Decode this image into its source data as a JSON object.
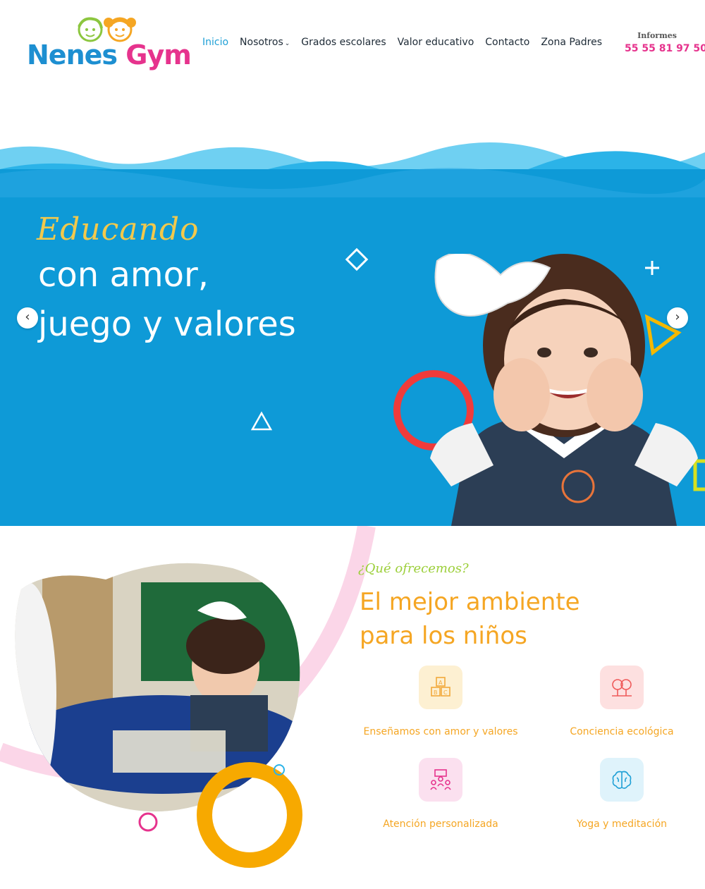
{
  "brand": {
    "name_part1": "Nenes",
    "name_part2": "Gym",
    "colors": {
      "blue": "#1d8fd1",
      "green": "#8cc63f",
      "orange": "#f5a623",
      "pink": "#e6338d"
    }
  },
  "nav": {
    "items": [
      {
        "label": "Inicio",
        "active": true
      },
      {
        "label": "Nosotros",
        "has_dropdown": true
      },
      {
        "label": "Grados escolares"
      },
      {
        "label": "Valor educativo"
      },
      {
        "label": "Contacto"
      },
      {
        "label": "Zona Padres"
      }
    ]
  },
  "informes": {
    "label": "Informes",
    "phone": "55 55 81 97 50"
  },
  "hero": {
    "script": "Educando",
    "line1": "con amor,",
    "line2": "juego y valores",
    "prev_icon": "chevron-left-icon",
    "next_icon": "chevron-right-icon",
    "background": "#0e9ad7"
  },
  "offer": {
    "kicker": "¿Qué ofrecemos?",
    "title": "El mejor ambiente para los niños",
    "features": [
      {
        "label": "Enseñamos con amor y valores",
        "icon": "abc-blocks-icon",
        "bg": "#fdf0d2",
        "stroke": "#f2a93b"
      },
      {
        "label": "Conciencia ecológica",
        "icon": "trees-icon",
        "bg": "#fde0e0",
        "stroke": "#ef5a5a"
      },
      {
        "label": "Atención personalizada",
        "icon": "teacher-group-icon",
        "bg": "#fbe0ef",
        "stroke": "#e6338d"
      },
      {
        "label": "Yoga y meditación",
        "icon": "brain-icon",
        "bg": "#dff3fb",
        "stroke": "#1fa0d6"
      }
    ]
  }
}
